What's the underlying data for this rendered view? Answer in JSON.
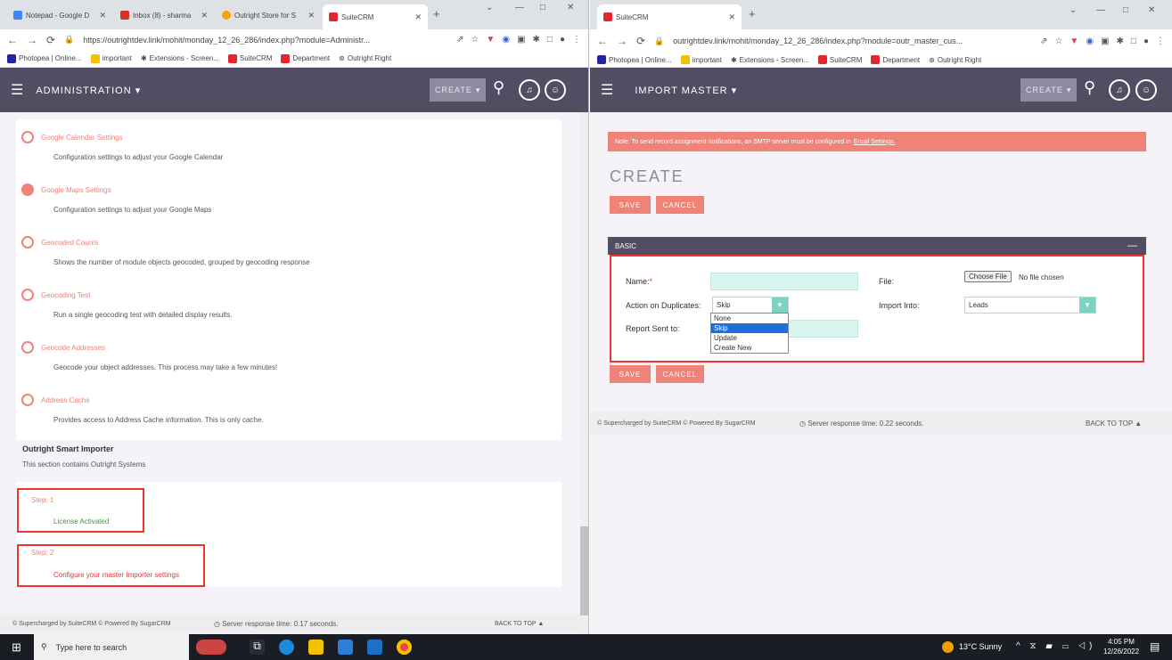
{
  "left": {
    "tabs": [
      {
        "label": "Notepad - Google D",
        "color": "#4285f4"
      },
      {
        "label": "Inbox (8) - sharma",
        "color": "#d93025"
      },
      {
        "label": "Outright Store for S",
        "color": "#f2a600"
      },
      {
        "label": "SuiteCRM",
        "color": "#e4252d"
      }
    ],
    "url": "https://outrightdev.link/mohit/monday_12_26_286/index.php?module=Administr...",
    "bookmarks": [
      "Photopea | Online...",
      "important",
      "Extensions - Screen...",
      "SuiteCRM",
      "Department",
      "Outright Right"
    ],
    "nav_title": "ADMINISTRATION",
    "create": "CREATE",
    "items": [
      {
        "title": "Google Calendar Settings",
        "desc": "Configuration settings to adjust your Google Calendar"
      },
      {
        "title": "Google Maps Settings",
        "desc": "Configuration settings to adjust your Google Maps"
      },
      {
        "title": "Geocoded Counts",
        "desc": "Shows the number of module objects geocoded, grouped by geocoding response"
      },
      {
        "title": "Geocoding Test",
        "desc": "Run a single geocoding test with detailed display results."
      },
      {
        "title": "Geocode Addresses",
        "desc": "Geocode your object addresses. This process may take a few minutes!"
      },
      {
        "title": "Address Cache",
        "desc": "Provides access to Address Cache information. This is only cache."
      }
    ],
    "section_title": "Outright Smart Importer",
    "section_desc": "This section contains Outright Systems",
    "step1_label": "Step: 1",
    "step1_value": "License Activated",
    "step2_label": "Step: 2",
    "step2_value": "Configure your master Importer settings",
    "footer_a": "© Supercharged by SuiteCRM   © Powered By SugarCRM",
    "footer_b": "Server response time: 0.17 seconds.",
    "back_to_top": "BACK TO TOP ▲"
  },
  "right": {
    "tab_label": "SuiteCRM",
    "url": "outrightdev.link/mohit/monday_12_26_286/index.php?module=outr_master_cus...",
    "bookmarks": [
      "Photopea | Online...",
      "important",
      "Extensions - Screen...",
      "SuiteCRM",
      "Department",
      "Outright Right"
    ],
    "nav_title": "IMPORT MASTER",
    "create": "CREATE",
    "notice": "Note: To send record assignment notifications, an SMTP server must be configured in",
    "notice_link": "Email Settings.",
    "heading": "CREATE",
    "save": "SAVE",
    "cancel": "CANCEL",
    "panel": "BASIC",
    "labels": {
      "name": "Name:",
      "required": "*",
      "file": "File:",
      "dups": "Action on Duplicates:",
      "import_into": "Import Into:",
      "report": "Report Sent to:"
    },
    "dup_value": "Skip",
    "dup_options": [
      "None",
      "Skip",
      "Update",
      "Create New"
    ],
    "choose_file": "Choose File",
    "no_file": "No file chosen",
    "import_into_value": "Leads",
    "footer_a": "© Supercharged by SuiteCRM   © Powered By SugarCRM",
    "footer_b": "Server response time: 0.22 seconds.",
    "back_to_top": "BACK TO TOP ▲"
  },
  "taskbar": {
    "search_placeholder": "Type here to search",
    "weather": "13°C  Sunny",
    "time": "4:05 PM",
    "date": "12/26/2022"
  }
}
